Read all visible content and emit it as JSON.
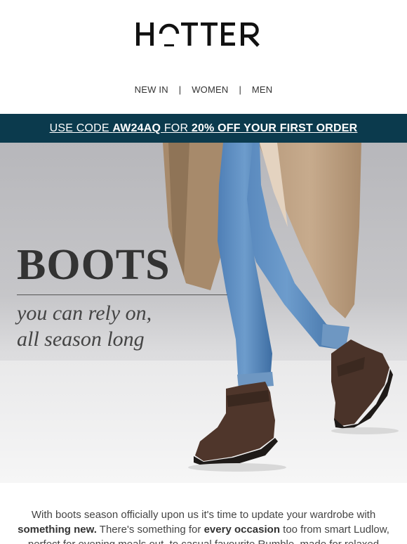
{
  "brand": {
    "name": "HOTTER"
  },
  "nav": {
    "items": [
      {
        "label": "NEW IN"
      },
      {
        "label": "WOMEN"
      },
      {
        "label": "MEN"
      }
    ],
    "separator": "|"
  },
  "promo": {
    "prefix": "USE CODE ",
    "code": "AW24AQ",
    "middle": " FOR ",
    "offer": "20% OFF YOUR FIRST ORDER",
    "background": "#0b3a4d"
  },
  "hero": {
    "title": "BOOTS",
    "subtitle_line1": "you can rely on,",
    "subtitle_line2": "all season long"
  },
  "body_copy": {
    "p1": "With boots season officially upon us it's time to update your wardrobe with ",
    "b1": "something new.",
    "p2": " There's something for ",
    "b2": "every occasion",
    "p3": " too from smart Ludlow, perfect for evening meals out, to casual favourite Rumble, made for relaxed weekend walks."
  },
  "colors": {
    "accent": "#0b3a4d",
    "text": "#333333"
  }
}
